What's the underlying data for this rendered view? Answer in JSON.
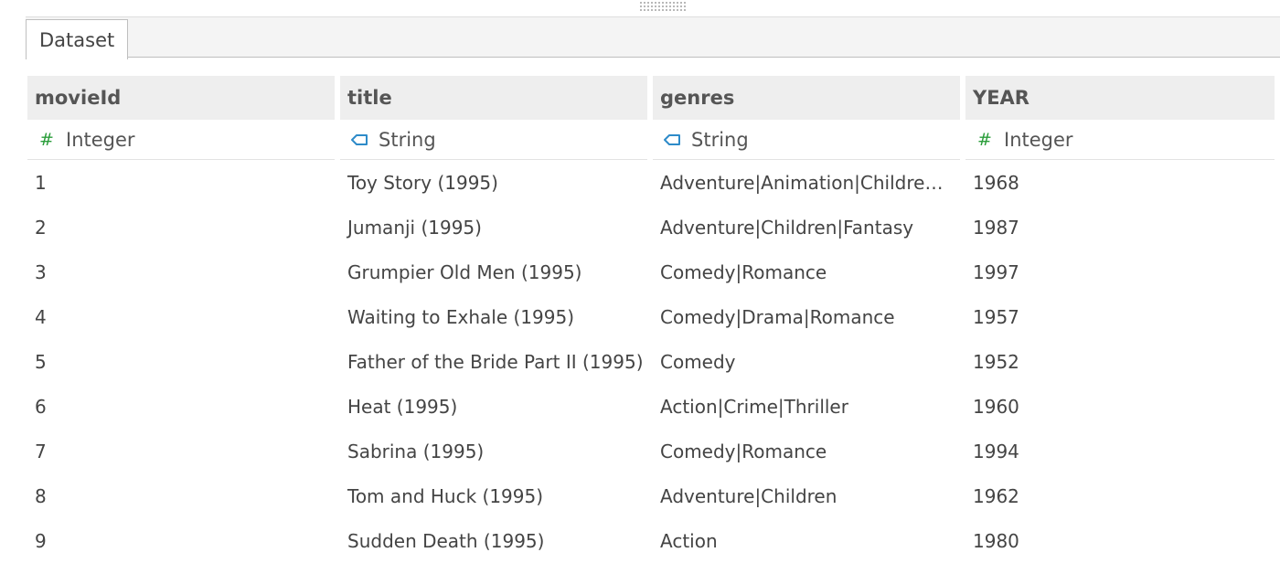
{
  "tabs": [
    {
      "label": "Dataset"
    }
  ],
  "columns": [
    {
      "name": "movieId",
      "type": "Integer",
      "type_icon": "hash-icon"
    },
    {
      "name": "title",
      "type": "String",
      "type_icon": "tag-icon"
    },
    {
      "name": "genres",
      "type": "String",
      "type_icon": "tag-icon"
    },
    {
      "name": "YEAR",
      "type": "Integer",
      "type_icon": "hash-icon"
    }
  ],
  "rows": [
    [
      "1",
      "Toy Story (1995)",
      "Adventure|Animation|Children|Comedy|Fantasy",
      "1968"
    ],
    [
      "2",
      "Jumanji (1995)",
      "Adventure|Children|Fantasy",
      "1987"
    ],
    [
      "3",
      "Grumpier Old Men (1995)",
      "Comedy|Romance",
      "1997"
    ],
    [
      "4",
      "Waiting to Exhale (1995)",
      "Comedy|Drama|Romance",
      "1957"
    ],
    [
      "5",
      "Father of the Bride Part II (1995)",
      "Comedy",
      "1952"
    ],
    [
      "6",
      "Heat (1995)",
      "Action|Crime|Thriller",
      "1960"
    ],
    [
      "7",
      "Sabrina (1995)",
      "Comedy|Romance",
      "1994"
    ],
    [
      "8",
      "Tom and Huck (1995)",
      "Adventure|Children",
      "1962"
    ],
    [
      "9",
      "Sudden Death (1995)",
      "Action",
      "1980"
    ]
  ],
  "colors": {
    "integer_icon": "#2a9d3a",
    "string_icon": "#2e8bc9",
    "header_bg": "#eeeeee"
  }
}
